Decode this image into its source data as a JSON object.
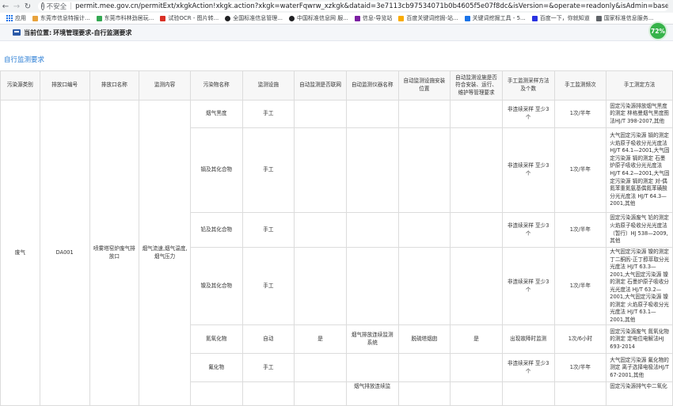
{
  "browser": {
    "insecure_label": "不安全",
    "url": "permit.mee.gov.cn/permitExt/xkgkAction!xkgk.action?xkgk=waterFqwrw_xzkgk&dataid=3e7113cb97534071b0b4605f5e07f8dc&isVersion=&operate=readonly&isAdmin=basetrue",
    "bookmarks": [
      {
        "label": "应用",
        "color": "#1a73e8"
      },
      {
        "label": "东莞市信息特报计...",
        "color": "#e8a33d"
      },
      {
        "label": "东莞市科林劲居玩...",
        "color": "#34a853"
      },
      {
        "label": "试验OCR - 图片转...",
        "color": "#d93025"
      },
      {
        "label": "全国标准信息管理...",
        "color": "#202124"
      },
      {
        "label": "中国标准信息网 服...",
        "color": "#202124"
      },
      {
        "label": "信息-导览站",
        "color": "#7b1fa2"
      },
      {
        "label": "百度关键词挖掘-站...",
        "color": "#f9ab00"
      },
      {
        "label": "关键词挖掘工具 - 5...",
        "color": "#1a73e8"
      },
      {
        "label": "百度一下，你就知道",
        "color": "#2932e1"
      },
      {
        "label": "国家标准信息服务...",
        "color": "#5f6368"
      }
    ]
  },
  "header": {
    "location_label": "当前位置:",
    "breadcrumb": "环境管理要求-自行监测要求"
  },
  "badge": "72%",
  "section_title": "自行监测要求",
  "table": {
    "headers": [
      "污染源类别",
      "排放口编号",
      "排放口名称",
      "监测内容",
      "污染物名称",
      "监测设施",
      "自动监测是否联网",
      "自动监测仪器名称",
      "自动监测设施安装位置",
      "自动监测设施是否符合安装、运行、维护等管理要求",
      "手工监测采样方法及个数",
      "手工监测频次",
      "手工测定方法"
    ],
    "group": {
      "category": "废气",
      "outlet_code": "DA001",
      "outlet_name": "喷雾塔窑炉废气排放口",
      "content": "烟气流速,烟气温度,烟气压力"
    },
    "rows": [
      {
        "pollutant": "烟气黑度",
        "facility": "手工",
        "networked": "",
        "instrument": "",
        "location": "",
        "compliant": "",
        "sampling": "非连续采样 至少3个",
        "frequency": "1次/半年",
        "method": "固定污染源排放烟气黑度的测定 林格曼烟气黑度图法HJ/T 398-2007,其他"
      },
      {
        "pollutant": "镉及其化合物",
        "facility": "手工",
        "networked": "",
        "instrument": "",
        "location": "",
        "compliant": "",
        "sampling": "非连续采样 至少3个",
        "frequency": "1次/半年",
        "method": "大气固定污染源 镉的测定 火焰原子吸收分光光度法 HJ/T 64.1—2001,大气固定污染源 镉的测定 石墨炉原子吸收分光光度法 HJ/T 64.2—2001,大气固定污染源 镉的测定 对-偶氮苯重氮氨基偶氮苯磺酸分光光度法 HJ/T 64.3—2001,其他"
      },
      {
        "pollutant": "铅及其化合物",
        "facility": "手工",
        "networked": "",
        "instrument": "",
        "location": "",
        "compliant": "",
        "sampling": "非连续采样 至少3个",
        "frequency": "1次/半年",
        "method": "固定污染源废气 铅的测定 火焰原子吸收分光光度法（暂行）HJ 538—2009,其他"
      },
      {
        "pollutant": "镍及其化合物",
        "facility": "手工",
        "networked": "",
        "instrument": "",
        "location": "",
        "compliant": "",
        "sampling": "非连续采样 至少3个",
        "frequency": "1次/半年",
        "method": "大气固定污染源 镍的测定 丁二酮肟-正丁醇萃取分光光度法 HJ/T 63.3—2001,大气固定污染源 镍的测定 石墨炉原子吸收分光光度法 HJ/T 63.2—2001,大气固定污染源 镍的测定 火焰原子吸收分光光度法 HJ/T 63.1—2001,其他"
      },
      {
        "pollutant": "氮氧化物",
        "facility": "自动",
        "networked": "是",
        "instrument": "烟气排放连续监测系统",
        "location": "脱硫塔烟囱",
        "compliant": "是",
        "sampling": "出现故障时监测",
        "frequency": "1次/6小时",
        "method": "固定污染源废气 氮氧化物的测定 定电位电解法HJ 693-2014"
      },
      {
        "pollutant": "氟化物",
        "facility": "手工",
        "networked": "",
        "instrument": "",
        "location": "",
        "compliant": "",
        "sampling": "非连续采样 至少3个",
        "frequency": "1次/半年",
        "method": "大气固定污染源 氟化物的测定 离子选择电极法HJ/T 67-2001,其他"
      },
      {
        "pollutant": "",
        "facility": "",
        "networked": "",
        "instrument": "烟气排放连续监",
        "location": "",
        "compliant": "",
        "sampling": "",
        "frequency": "",
        "method": "固定污染源排气中二氧化"
      }
    ]
  }
}
